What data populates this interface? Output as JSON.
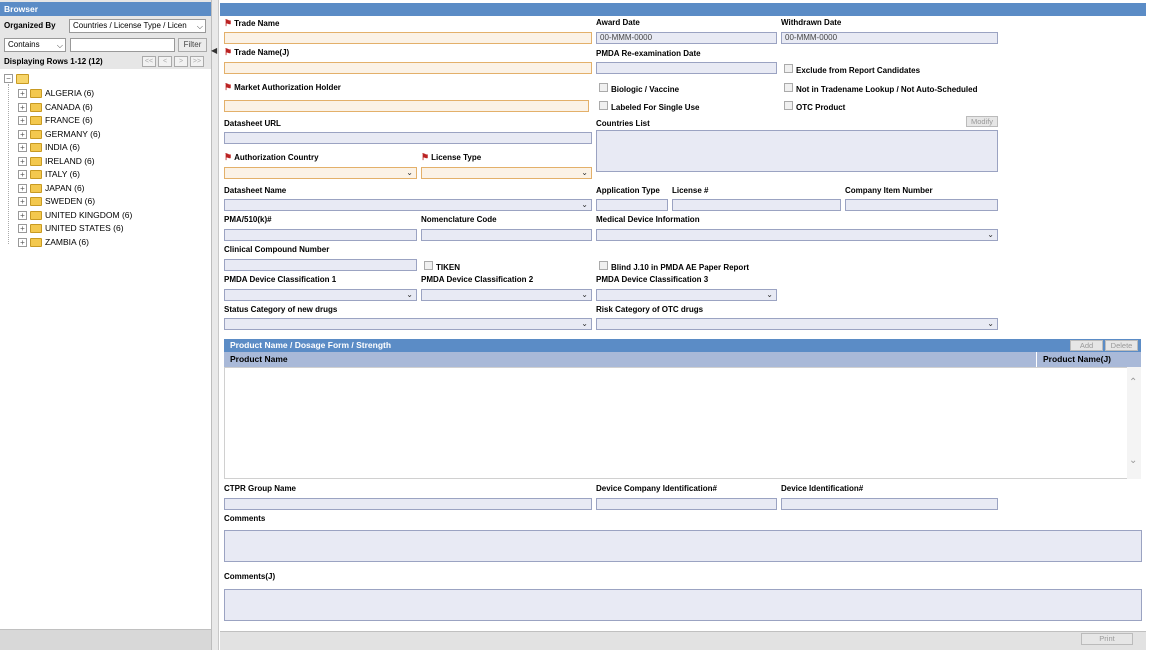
{
  "browser": {
    "title": "Browser",
    "organized_by_label": "Organized By",
    "organized_by_value": "Countries / License Type / Licen",
    "filter_mode": "Contains",
    "filter_value": "",
    "filter_button": "Filter",
    "displaying": "Displaying Rows 1-12 (12)",
    "pager": [
      "<<",
      "<",
      ">",
      ">>"
    ],
    "tree": [
      {
        "label": "ALGERIA (6)"
      },
      {
        "label": "CANADA (6)"
      },
      {
        "label": "FRANCE (6)"
      },
      {
        "label": "GERMANY (6)"
      },
      {
        "label": "INDIA (6)"
      },
      {
        "label": "IRELAND (6)"
      },
      {
        "label": "ITALY (6)"
      },
      {
        "label": "JAPAN (6)"
      },
      {
        "label": "SWEDEN (6)"
      },
      {
        "label": "UNITED KINGDOM (6)"
      },
      {
        "label": "UNITED STATES (6)"
      },
      {
        "label": "ZAMBIA (6)"
      }
    ]
  },
  "form": {
    "trade_name": "Trade Name",
    "award_date": "Award Date",
    "award_date_value": "00-MMM-0000",
    "withdrawn_date": "Withdrawn Date",
    "withdrawn_date_value": "00-MMM-0000",
    "trade_name_j": "Trade Name(J)",
    "pmda_reexam": "PMDA Re-examination Date",
    "exclude_report": "Exclude from Report Candidates",
    "mah": "Market Authorization Holder",
    "biologic": "Biologic / Vaccine",
    "not_in_tradename": "Not in Tradename Lookup / Not Auto-Scheduled",
    "labeled_single_use": "Labeled For Single Use",
    "otc_product": "OTC Product",
    "datasheet_url": "Datasheet URL",
    "countries_list": "Countries List",
    "modify_button": "Modify",
    "authorization_country": "Authorization Country",
    "license_type": "License Type",
    "datasheet_name": "Datasheet Name",
    "application_type": "Application Type",
    "license_no": "License #",
    "company_item_number": "Company Item Number",
    "pma": "PMA/510(k)#",
    "nomenclature": "Nomenclature Code",
    "medical_device_info": "Medical Device Information",
    "clinical_compound": "Clinical Compound Number",
    "tiken": "TIKEN",
    "blind_j10": "Blind J.10 in PMDA AE Paper Report",
    "pmda_class1": "PMDA Device Classification 1",
    "pmda_class2": "PMDA Device Classification 2",
    "pmda_class3": "PMDA Device Classification 3",
    "status_category": "Status Category of new drugs",
    "risk_category": "Risk Category of OTC drugs",
    "ctpr_group": "CTPR Group Name",
    "device_company_id": "Device Company Identification#",
    "device_id": "Device Identification#",
    "comments": "Comments",
    "comments_j": "Comments(J)"
  },
  "grid": {
    "title": "Product Name / Dosage Form / Strength",
    "add_button": "Add",
    "delete_button": "Delete",
    "col_product_name": "Product Name",
    "col_product_name_j": "Product Name(J)"
  },
  "footer": {
    "print_button": "Print"
  },
  "colors": {
    "header_blue": "#5b8cc6",
    "grid_head": "#a9b9d8",
    "field_bg": "#e8eaf4",
    "required_field_bg": "#fbf2e6"
  }
}
